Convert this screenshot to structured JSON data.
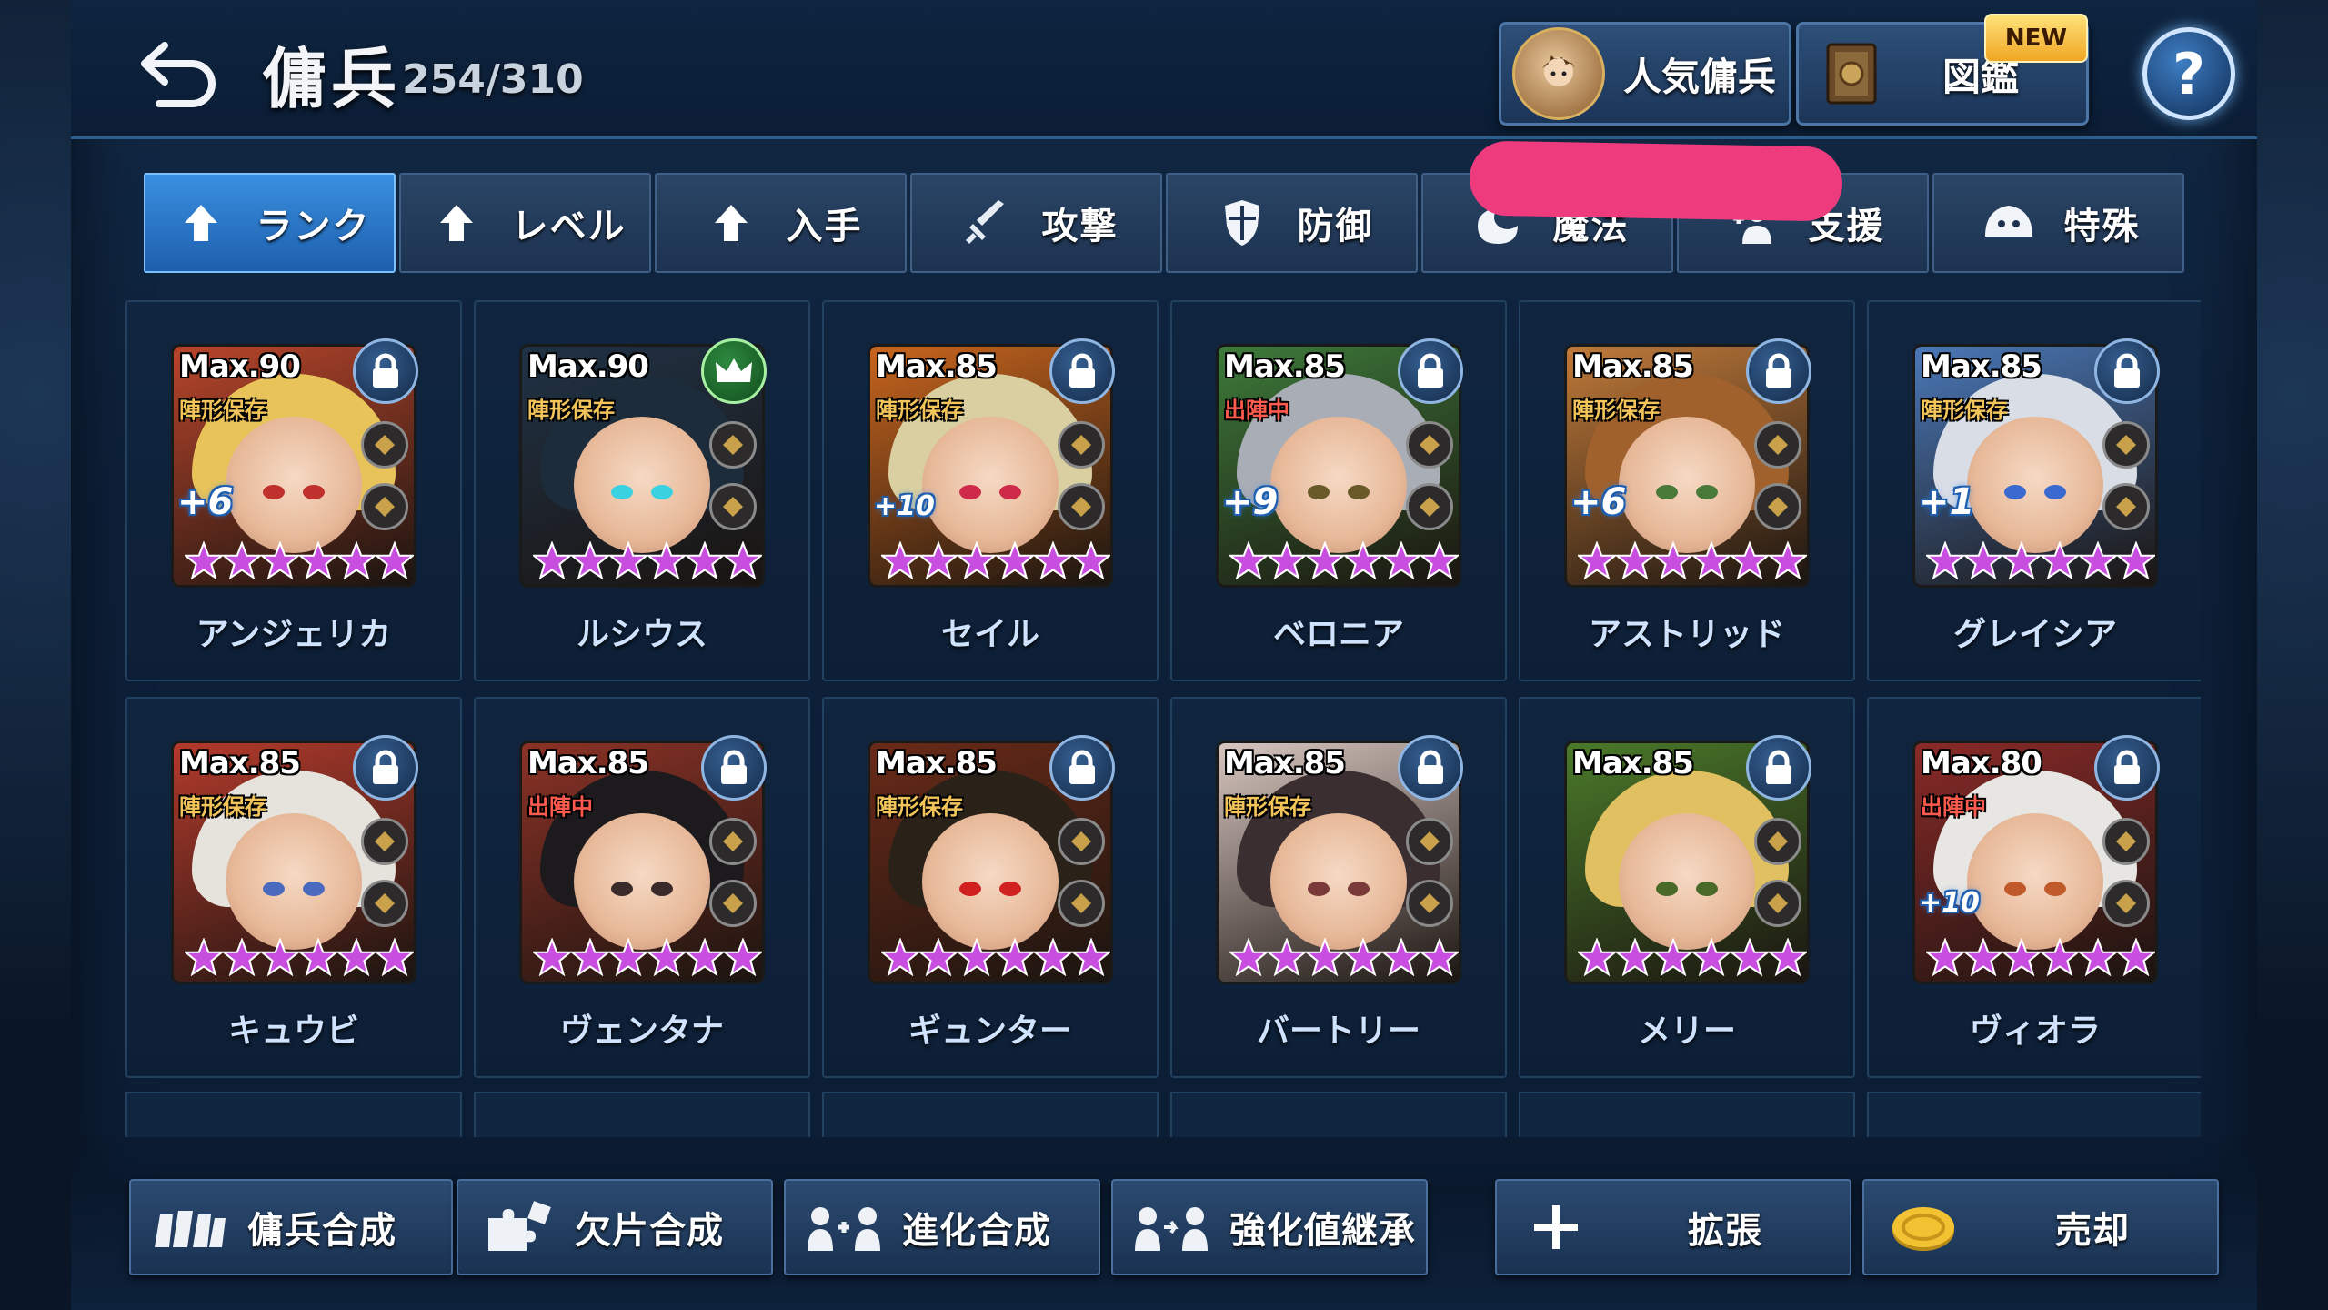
{
  "header": {
    "title": "傭兵",
    "count": "254/310",
    "popular_label": "人気傭兵",
    "encyclopedia_label": "図鑑",
    "new_badge": "NEW",
    "help_label": "?"
  },
  "tabs": [
    {
      "label": "ランク",
      "icon": "arrow-up-icon",
      "active": true
    },
    {
      "label": "レベル",
      "icon": "arrow-up-icon"
    },
    {
      "label": "入手",
      "icon": "arrow-up-icon"
    },
    {
      "label": "攻撃",
      "icon": "sword-icon"
    },
    {
      "label": "防御",
      "icon": "shield-icon"
    },
    {
      "label": "魔法",
      "icon": "magic-icon"
    },
    {
      "label": "支援",
      "icon": "support-icon"
    },
    {
      "label": "特殊",
      "icon": "special-icon"
    }
  ],
  "mercenaries": [
    {
      "name": "アンジェリカ",
      "max": "Max.90",
      "status": "陣形保存",
      "plus": "+6",
      "lock": "lock",
      "hair": "#e8c35a",
      "bg": "#b8452b",
      "eye": "#c0302c"
    },
    {
      "name": "ルシウス",
      "max": "Max.90",
      "status": "陣形保存",
      "plus": "",
      "lock": "crown",
      "hair": "#1c2c3a",
      "bg": "#203246",
      "eye": "#3ad2e0"
    },
    {
      "name": "セイル",
      "max": "Max.85",
      "status": "陣形保存",
      "plus": "+10",
      "lock": "lock",
      "hair": "#d9cfa0",
      "bg": "#c8651e",
      "eye": "#d02a4a"
    },
    {
      "name": "ベロニア",
      "max": "Max.85",
      "status": "出陣中",
      "plus": "+9",
      "lock": "lock",
      "hair": "#a9adb5",
      "bg": "#3d7a3a",
      "eye": "#6a5a2a"
    },
    {
      "name": "アストリッド",
      "max": "Max.85",
      "status": "陣形保存",
      "plus": "+6",
      "lock": "lock",
      "hair": "#a0612c",
      "bg": "#c07a3a",
      "eye": "#4a7a3a"
    },
    {
      "name": "グレイシア",
      "max": "Max.85",
      "status": "陣形保存",
      "plus": "+1",
      "lock": "lock",
      "hair": "#d8dde6",
      "bg": "#4a78b8",
      "eye": "#3a6ad0"
    },
    {
      "name": "キュウビ",
      "max": "Max.85",
      "status": "陣形保存",
      "plus": "",
      "lock": "lock",
      "hair": "#e6e2dc",
      "bg": "#b33a2c",
      "eye": "#4a6ac0"
    },
    {
      "name": "ヴェンタナ",
      "max": "Max.85",
      "status": "出陣中",
      "plus": "",
      "lock": "lock",
      "hair": "#1d1a1e",
      "bg": "#8c3226",
      "eye": "#3a2a2a"
    },
    {
      "name": "ギュンター",
      "max": "Max.85",
      "status": "陣形保存",
      "plus": "",
      "lock": "lock",
      "hair": "#2a2218",
      "bg": "#6a2a18",
      "eye": "#d02020"
    },
    {
      "name": "バートリー",
      "max": "Max.85",
      "status": "陣形保存",
      "plus": "",
      "lock": "lock",
      "hair": "#3a2e30",
      "bg": "#d8c6c0",
      "eye": "#7a3a3a"
    },
    {
      "name": "メリー",
      "max": "Max.85",
      "status": "",
      "plus": "",
      "lock": "lock",
      "hair": "#e0c060",
      "bg": "#4a7a2a",
      "eye": "#4a6a2a"
    },
    {
      "name": "ヴィオラ",
      "max": "Max.80",
      "status": "出陣中",
      "plus": "+10",
      "lock": "lock",
      "hair": "#e8e6e2",
      "bg": "#8a2a28",
      "eye": "#c05a2a"
    }
  ],
  "bottom": [
    {
      "label": "傭兵合成",
      "icon": "mercenary-group-icon"
    },
    {
      "label": "欠片合成",
      "icon": "puzzle-icon"
    },
    {
      "label": "進化合成",
      "icon": "evolve-icon"
    },
    {
      "label": "強化値継承",
      "icon": "inherit-icon"
    },
    {
      "label": "拡張",
      "icon": "plus-icon"
    },
    {
      "label": "売却",
      "icon": "coin-icon"
    }
  ],
  "colors": {
    "accent": "#3a8fe0",
    "star": "#c84ee0",
    "panel": "#10253f"
  }
}
